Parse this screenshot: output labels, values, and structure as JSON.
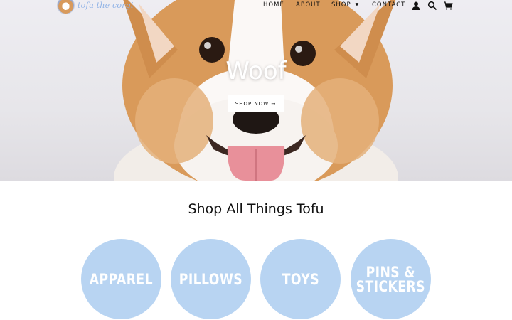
{
  "brand": {
    "name": "tofu the corgi"
  },
  "nav": {
    "items": [
      {
        "id": "home",
        "label": "HOME"
      },
      {
        "id": "about",
        "label": "ABOUT"
      },
      {
        "id": "shop",
        "label": "SHOP"
      },
      {
        "id": "contact",
        "label": "CONTACT"
      }
    ],
    "icons": [
      "account-icon",
      "search-icon",
      "cart-icon"
    ]
  },
  "hero": {
    "title": "Woof",
    "cta_label": "SHOP NOW →"
  },
  "section": {
    "title": "Shop All Things Tofu",
    "categories": [
      {
        "label": "APPAREL"
      },
      {
        "label": "PILLOWS"
      },
      {
        "label": "TOYS"
      },
      {
        "label": "PINS &\nSTICKERS"
      }
    ]
  },
  "colors": {
    "brand_blue": "#8eb1e6",
    "category_bg": "#b8d4f2",
    "text": "#111111",
    "white": "#ffffff"
  }
}
